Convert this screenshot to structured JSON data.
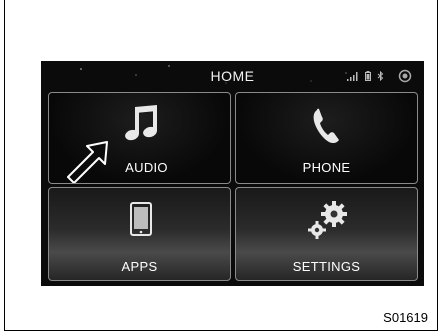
{
  "screen": {
    "title": "HOME",
    "status_icons": [
      "signal-bars-icon",
      "battery-icon",
      "bluetooth-icon",
      "settings-dot-icon"
    ]
  },
  "tiles": [
    {
      "label": "AUDIO",
      "icon": "music-note-icon"
    },
    {
      "label": "PHONE",
      "icon": "phone-handset-icon"
    },
    {
      "label": "APPS",
      "icon": "tablet-icon"
    },
    {
      "label": "SETTINGS",
      "icon": "gears-icon"
    }
  ],
  "figure_id": "S01619"
}
